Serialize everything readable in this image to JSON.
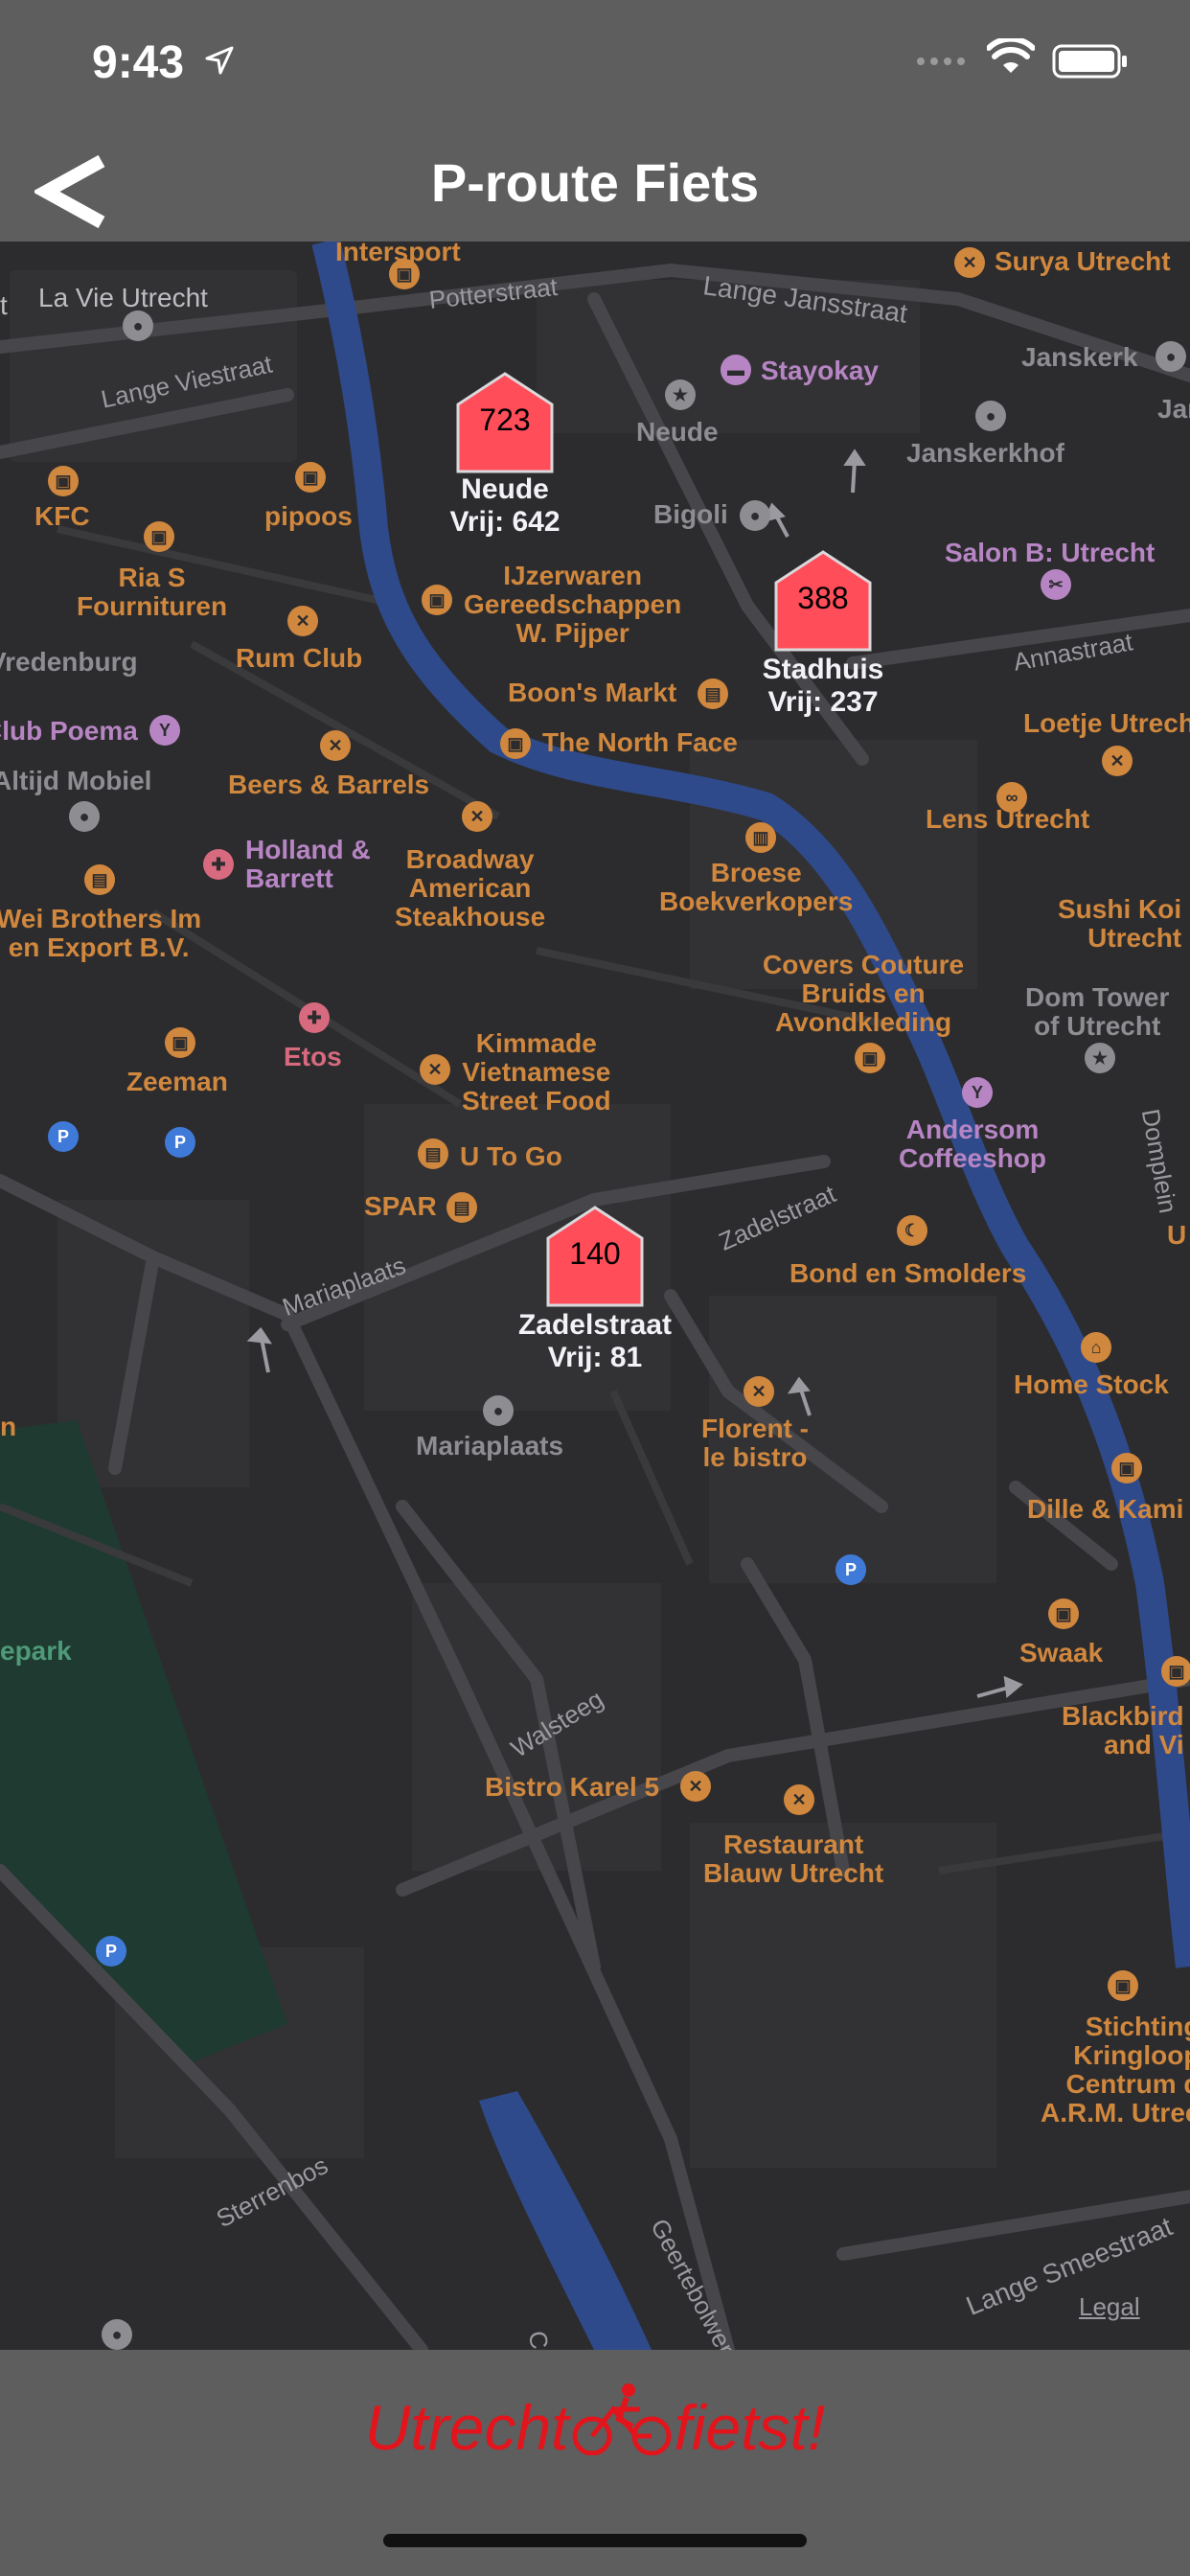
{
  "status": {
    "time": "9:43"
  },
  "nav": {
    "title": "P-route Fiets",
    "back_label": "<"
  },
  "parkings": [
    {
      "count": "723",
      "name": "Neude",
      "free": "Vrij: 642"
    },
    {
      "count": "388",
      "name": "Stadhuis",
      "free": "Vrij: 237"
    },
    {
      "count": "140",
      "name": "Zadelstraat",
      "free": "Vrij: 81"
    }
  ],
  "pois": {
    "intersport": "Intersport",
    "surya": "Surya Utrecht",
    "la_vie": "La Vie Utrecht",
    "stayokay": "Stayokay",
    "neude": "Neude",
    "janskerk": "Janskerk",
    "janskerkhof": "Janskerkhof",
    "kfc": "KFC",
    "pipoos": "pipoos",
    "bigoli": "Bigoli",
    "salon_b": "Salon B: Utrecht",
    "ria_s": "Ria S\nFournituren",
    "ijzerwaren": "IJzerwaren\nGereedschappen\nW. Pijper",
    "rum_club": "Rum Club",
    "vredenburg": "Vredenburg",
    "boons_markt": "Boon's Markt",
    "club_poema": "Club Poema",
    "loetje": "Loetje Utrecht",
    "north_face": "The North Face",
    "altijd_mobiel": "Altijd Mobiel",
    "beers_barrels": "Beers & Barrels",
    "lens_utrecht": "Lens Utrecht",
    "holland_barrett": "Holland &\nBarrett",
    "broadway": "Broadway\nAmerican\nSteakhouse",
    "broese": "Broese\nBoekverkopers",
    "sushi_koi": "Sushi Koi\nUtrecht",
    "wei_brothers": "Wei Brothers Im\nen Export B.V.",
    "covers_couture": "Covers Couture\nBruids en\nAvondkleding",
    "dom_tower": "Dom Tower\nof Utrecht",
    "zeeman": "Zeeman",
    "etos": "Etos",
    "kimmade": "Kimmade\nVietnamese\nStreet Food",
    "andersom": "Andersom\nCoffeeshop",
    "u_to_go": "U To Go",
    "spar": "SPAR",
    "bond": "Bond en Smolders",
    "home_stock": "Home Stock",
    "mariaplaats": "Mariaplaats",
    "florent": "Florent -\nle bistro",
    "dille": "Dille & Kami",
    "epark": "epark",
    "swaak": "Swaak",
    "blackbird": "Blackbird\nand Vi",
    "bistro_karel": "Bistro Karel 5",
    "restaurant_blauw": "Restaurant\nBlauw Utrecht",
    "stichting": "Stichting\nKringloop\nCentrum d\nA.R.M. Utrec",
    "n_edge": "n",
    "u_edge": "U",
    "jan_edge": "Jan",
    "t_edge": "t"
  },
  "streets": {
    "potterstraat": "Potterstraat",
    "lange_jansstraat": "Lange Jansstraat",
    "lange_viestraat": "Lange Viestraat",
    "annastraat": "Annastraat",
    "zadelstraat": "Zadelstraat",
    "mariaplaats": "Mariaplaats",
    "walsteeg": "Walsteeg",
    "sterrenbos": "Sterrenbos",
    "geertebolwerk": "Geertebolwerk",
    "lange_smeestraat": "Lange Smeestraat",
    "domplein": "Domplein",
    "c_edge": "C"
  },
  "map_legal": "Legal",
  "footer": {
    "brand_left": "Utrecht",
    "brand_right": "fietst!"
  },
  "colors": {
    "accent_red": "#e3141b",
    "marker_fill": "#ff4d5a",
    "poi_orange": "#d0873e",
    "canal_blue": "#2f4a8a",
    "park_green": "#1f3a30"
  },
  "icons": [
    "location-arrow-icon",
    "signal-icon",
    "wifi-icon",
    "battery-icon",
    "back-chevron-icon",
    "parking-marker-icon",
    "cyclist-icon"
  ]
}
